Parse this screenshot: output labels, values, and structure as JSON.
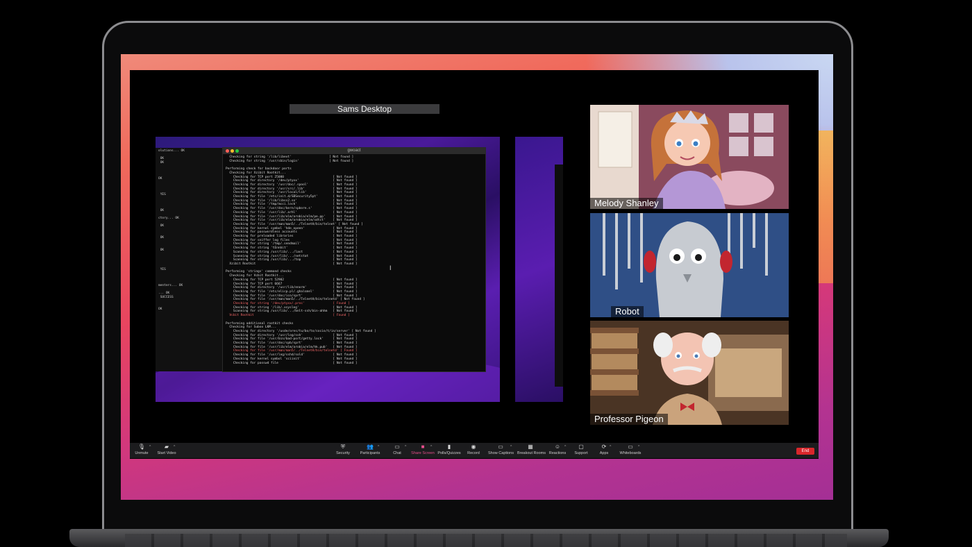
{
  "share": {
    "title": "Sams Desktop"
  },
  "terminal": {
    "title": "gwoact",
    "lines": [
      "  Checking for string '/lib/libext'                    [ Not found ]",
      "  Checking for string '/usr/sbin/login'                [ Not found ]",
      "",
      "Performing check for backdoor ports",
      "  Checking for Xzibit Rootkit...",
      "    Checking for TCP port 25000                          [ Not found ]",
      "    Checking for directory '/dev/ptyxx'                  [ Not found ]",
      "    Checking for directory '/usr/doc/.spool'             [ Not found ]",
      "    Checking for directory '/usr/src/.lib'               [ Not found ]",
      "    Checking for directory '/usr/local/lib'              [ Not found ]",
      "    Checking for file '/etc/init.d/SBSecurity5pt'        [ Not found ]",
      "    Checking for file '/lib/libss2.so'                   [ Not found ]",
      "    Checking for file '/tmp/mcci.lock'                   [ Not found ]",
      "    Checking for file '/usr/doc/kern/spbore.s'           [ Not found ]",
      "    Checking for file '/usr/lib/.arhl'                   [ Not found ]",
      "    Checking for file '/usr/lib/elm/arobia/elm/pe.pp'    [ Not found ]",
      "    Checking for file '/usr/lib/elm/arobia/elm/sdtct'    [ Not found ]",
      "    Checking for file '/usr/man/man5/../TelnetH/bin/telnet' [ Not found ]",
      "    Checking for kernel symbol 'hde_opeen'               [ Not found ]",
      "    Checking for passwordless accounts                   [ Not found ]",
      "    Checking for preloaded libraries                     [ Not found ]",
      "    Checking for sniffer log files                       [ Not found ]",
      "    Checking for string '/tmp/.sendmail'                 [ Not found ]",
      "    Checking for string 'tEnnbit'                        [ Not found ]",
      "    Scanning for string /usr/lib/.../last                [ Not found ]",
      "    Scanning for string /usr/lib/.../netstat             [ Not found ]",
      "    Scanning for string /usr/lib/.../top                 [ Not found ]",
      "  Xzibit Rootkit                                         [ Not found ]",
      "",
      "Performing 'strings' command checks",
      "  Checking for Vcbit Rootkit...",
      "    Checking for TCP port 52902                          [ Not found ]",
      "    Checking for TCP port 6667                           [ Not found ]",
      "    Checking for directory '/usr/lib/enorm'              [ Not found ]",
      "    Checking for file '/etc/elicp.pl/.ghalsmel'          [ Not found ]",
      "    Checking for file '/usr/doc/ico/sprt'                [ Not found ]",
      "    Checking for file '/usr/man/man5/../TelnetH/bin/telnetd' [ Not found ]",
      "    Checking for string '/dev/ptyxx/.proc'               [ Found ]",
      "    Checking for string '/lib/.xsysleg'                  [ Not found ]",
      "    Scanning for string /usr/lib/.../bnlt-ssh/bin-ahhm   [ Not found ]",
      "  Vcbit Rootkit                                          [ Found ]",
      "",
      "Performing additional rootkit checks",
      "  Checking for Suboo LKM...",
      "    Checking for directory '/usde/ores/tu/bo/to/socio/t/in/server' [ Not found ]",
      "    Checking for directory '/usr/log/ssh'                [ Not found ]",
      "    Checking for file '/usr/bin/bad-port/getty.lock'     [ Not found ]",
      "    Checking for file '/usr/doc/spb/sprt'                [ Not found ]",
      "    Checking for file '/usr/lib/elm/arobia/elm/hk.pub'   [ Not found ]",
      "    Checking for file '/usr/man/man5/../TelnetH/bin/telnetd' [ Found ]",
      "    Checking for file '/usr/log/sshd/sold'               [ Not found ]",
      "    Checking for kernel symbol 'sciinit'                 [ Not found ]",
      "    Checking for passwd file                             [ Not found ]"
    ]
  },
  "left_terminal": {
    "lines": [
      "olutions... OK",
      "",
      " OK",
      " OK",
      "",
      "",
      "",
      "OK",
      "",
      "",
      "",
      " YES",
      "",
      "",
      "",
      " OK",
      "",
      "ctory... OK",
      "",
      " OK",
      "",
      "",
      " OK",
      "",
      "",
      " OK",
      "",
      "",
      "",
      "",
      " YES",
      "",
      "",
      "",
      "menters... OK",
      "",
      "... OK",
      " SUCCESS",
      "",
      "",
      "OK"
    ]
  },
  "participants": [
    {
      "name": "Melody Shanley"
    },
    {
      "name": "Robot"
    },
    {
      "name": "Professor Pigeon"
    }
  ],
  "toolbar": {
    "unmute": "Unmute",
    "start_video": "Start Video",
    "security": "Security",
    "participants": "Participants",
    "chat": "Chat",
    "share_screen": "Share Screen",
    "polls": "Polls/Quizzes",
    "record": "Record",
    "captions": "Show Captions",
    "breakout": "Breakout Rooms",
    "reactions": "Reactions",
    "support": "Support",
    "apps": "Apps",
    "whiteboards": "Whiteboards",
    "end": "End"
  },
  "colors": {
    "accent_share": "#e94e8d",
    "end_red": "#d9262b"
  }
}
